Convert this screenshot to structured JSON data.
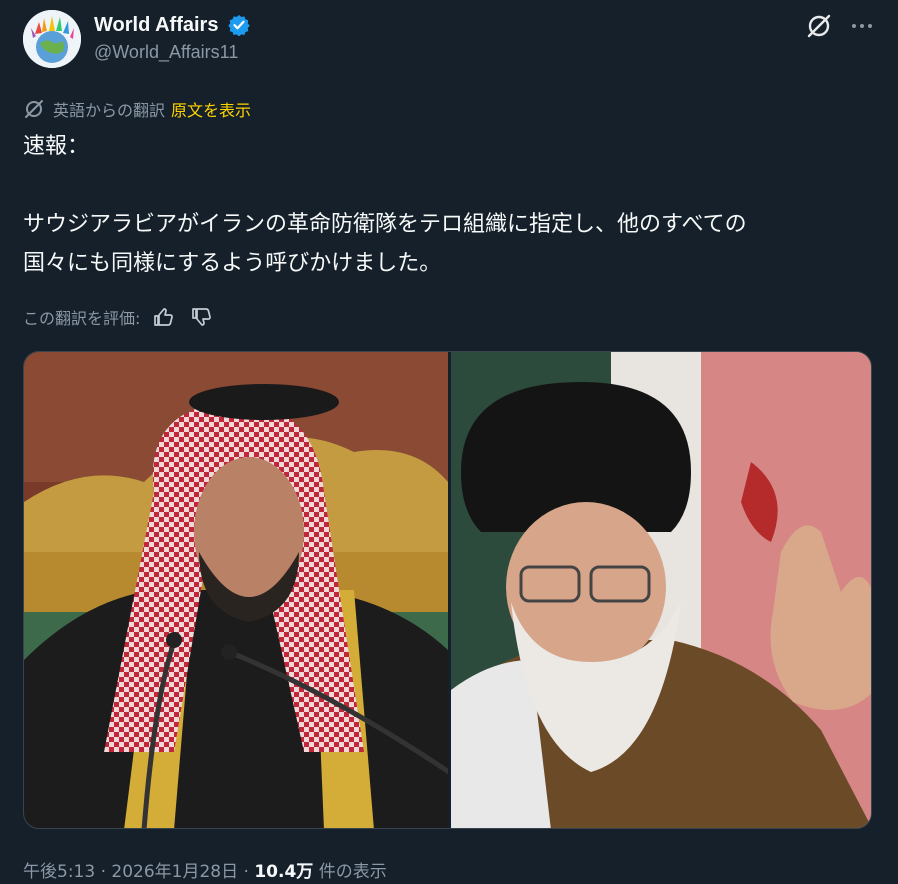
{
  "tweet": {
    "display_name": "World Affairs",
    "handle": "@World_Affairs11",
    "verified": true,
    "translated_label": "英語からの翻訳",
    "show_original_label": "原文を表示",
    "text": "速報：\n\nサウジアラビアがイランの革命防衛隊をテロ組織に指定し、他のすべての\n国々にも同様にするよう呼びかけました。",
    "rate_translation_label": "この翻訳を評価:",
    "time": "午後5:13",
    "separator": "·",
    "date": "2026年1月28日",
    "views_count": "10.4万",
    "views_label": "件の表示"
  },
  "icons": {
    "avatar": "globe-hands-logo",
    "verified": "verified-badge-icon",
    "grok": "grok-icon",
    "more": "more-dots-icon",
    "translate": "translate-icon",
    "thumbs_up": "thumbs-up-icon",
    "thumbs_down": "thumbs-down-icon"
  },
  "colors": {
    "background": "#15202b",
    "text": "#f7f9f9",
    "secondary": "#8b98a5",
    "verified": "#1d9bf0",
    "link_yellow": "#ffd400"
  }
}
